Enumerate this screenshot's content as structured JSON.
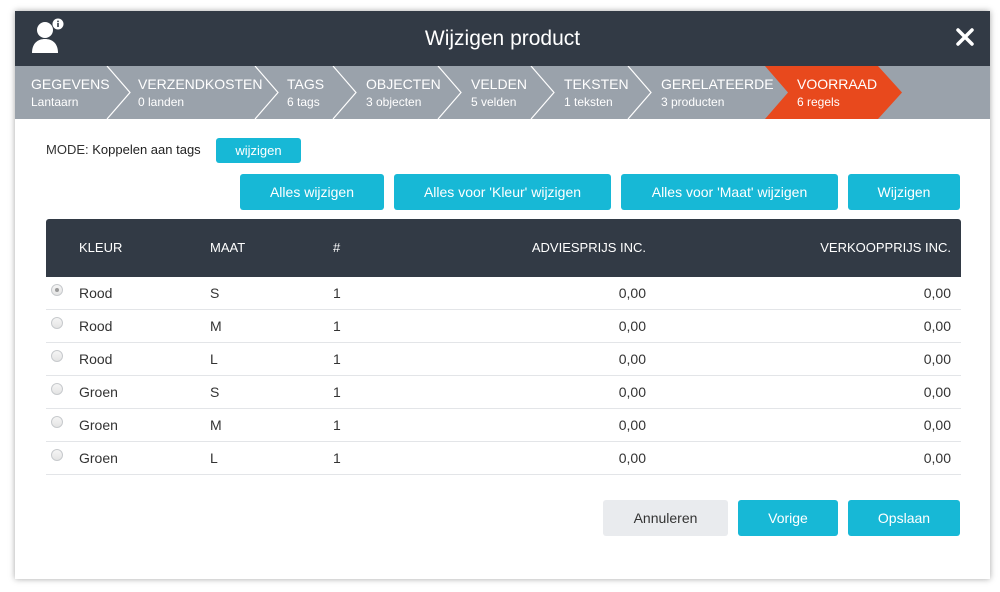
{
  "dialog": {
    "title": "Wijzigen product",
    "user_icon": "user-info-icon",
    "close_icon": "close-icon"
  },
  "steps": [
    {
      "title": "GEGEVENS",
      "sub": "Lantaarn",
      "active": false
    },
    {
      "title": "VERZENDKOSTEN",
      "sub": "0 landen",
      "active": false
    },
    {
      "title": "TAGS",
      "sub": "6 tags",
      "active": false
    },
    {
      "title": "OBJECTEN",
      "sub": "3 objecten",
      "active": false
    },
    {
      "title": "VELDEN",
      "sub": "5 velden",
      "active": false
    },
    {
      "title": "TEKSTEN",
      "sub": "1 teksten",
      "active": false
    },
    {
      "title": "GERELATEERDE",
      "sub": "3 producten",
      "active": false
    },
    {
      "title": "VOORRAAD",
      "sub": "6 regels",
      "active": true
    }
  ],
  "mode": {
    "label": "MODE:",
    "value": "Koppelen aan tags",
    "change_button": "wijzigen"
  },
  "actions": {
    "all": "Alles wijzigen",
    "color": "Alles voor 'Kleur' wijzigen",
    "size": "Alles voor 'Maat' wijzigen",
    "edit": "Wijzigen"
  },
  "table": {
    "headers": {
      "kleur": "KLEUR",
      "maat": "MAAT",
      "count": "#",
      "advies": "ADVIESPRIJS INC.",
      "verkoop": "VERKOOPPRIJS INC."
    },
    "rows": [
      {
        "kleur": "Rood",
        "maat": "S",
        "count": "1",
        "advies": "0,00",
        "verkoop": "0,00",
        "selected": true
      },
      {
        "kleur": "Rood",
        "maat": "M",
        "count": "1",
        "advies": "0,00",
        "verkoop": "0,00",
        "selected": false
      },
      {
        "kleur": "Rood",
        "maat": "L",
        "count": "1",
        "advies": "0,00",
        "verkoop": "0,00",
        "selected": false
      },
      {
        "kleur": "Groen",
        "maat": "S",
        "count": "1",
        "advies": "0,00",
        "verkoop": "0,00",
        "selected": false
      },
      {
        "kleur": "Groen",
        "maat": "M",
        "count": "1",
        "advies": "0,00",
        "verkoop": "0,00",
        "selected": false
      },
      {
        "kleur": "Groen",
        "maat": "L",
        "count": "1",
        "advies": "0,00",
        "verkoop": "0,00",
        "selected": false
      }
    ]
  },
  "footer": {
    "cancel": "Annuleren",
    "previous": "Vorige",
    "save": "Opslaan"
  },
  "colors": {
    "header_bg": "#323a45",
    "steps_bg": "#9aa2ab",
    "active_step": "#e8491d",
    "accent": "#17b8d6",
    "cancel_bg": "#e9ebee"
  }
}
